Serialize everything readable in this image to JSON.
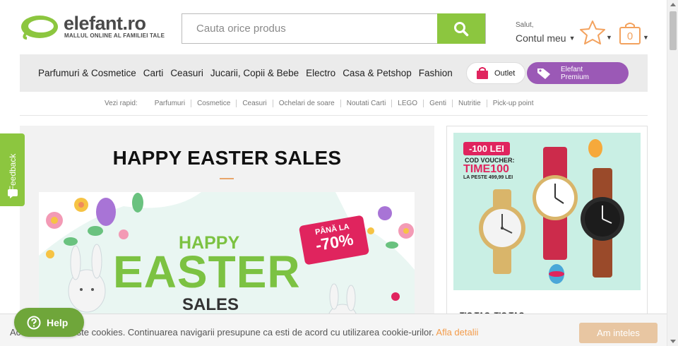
{
  "header": {
    "logo_name": "elefant.ro",
    "logo_tagline": "MALLUL ONLINE AL FAMILIEI TALE",
    "search_placeholder": "Cauta orice produs",
    "account_greeting": "Salut,",
    "account_label": "Contul meu",
    "cart_count": "0"
  },
  "nav": {
    "categories": [
      "Parfumuri & Cosmetice",
      "Carti",
      "Ceasuri",
      "Jucarii, Copii & Bebe",
      "Electro",
      "Casa & Petshop",
      "Fashion"
    ],
    "outlet_label": "Outlet",
    "premium_label": "Elefant Premium"
  },
  "quick_links": {
    "label": "Vezi rapid:",
    "items": [
      "Parfumuri",
      "Cosmetice",
      "Ceasuri",
      "Ochelari de soare",
      "Noutati Carti",
      "LEGO",
      "Genti",
      "Nutritie",
      "Pick-up point"
    ]
  },
  "main": {
    "headline": "HAPPY EASTER SALES",
    "banner": {
      "line1": "HAPPY",
      "line2": "EASTER",
      "line3": "SALES",
      "badge_top": "PÂNĂ LA",
      "badge_value": "-70%"
    }
  },
  "side": {
    "voucher_amount": "-100 LEI",
    "voucher_label": "COD VOUCHER:",
    "voucher_code": "TIME100",
    "voucher_condition": "LA PESTE 499,99 LEI",
    "caption": "TIC TAC, TIC TAC"
  },
  "feedback": {
    "label": "Feedback"
  },
  "cookie": {
    "text": "Acest site foloseste cookies. Continuarea navigarii presupune ca esti de acord cu utilizarea cookie-urilor.",
    "link": "Afla detalii",
    "button": "Am inteles"
  },
  "help": {
    "label": "Help"
  },
  "colors": {
    "brand_green": "#8cc63f",
    "premium_purple": "#9b59b6",
    "accent_orange": "#f39c4b",
    "outlet_red": "#e0245e"
  }
}
